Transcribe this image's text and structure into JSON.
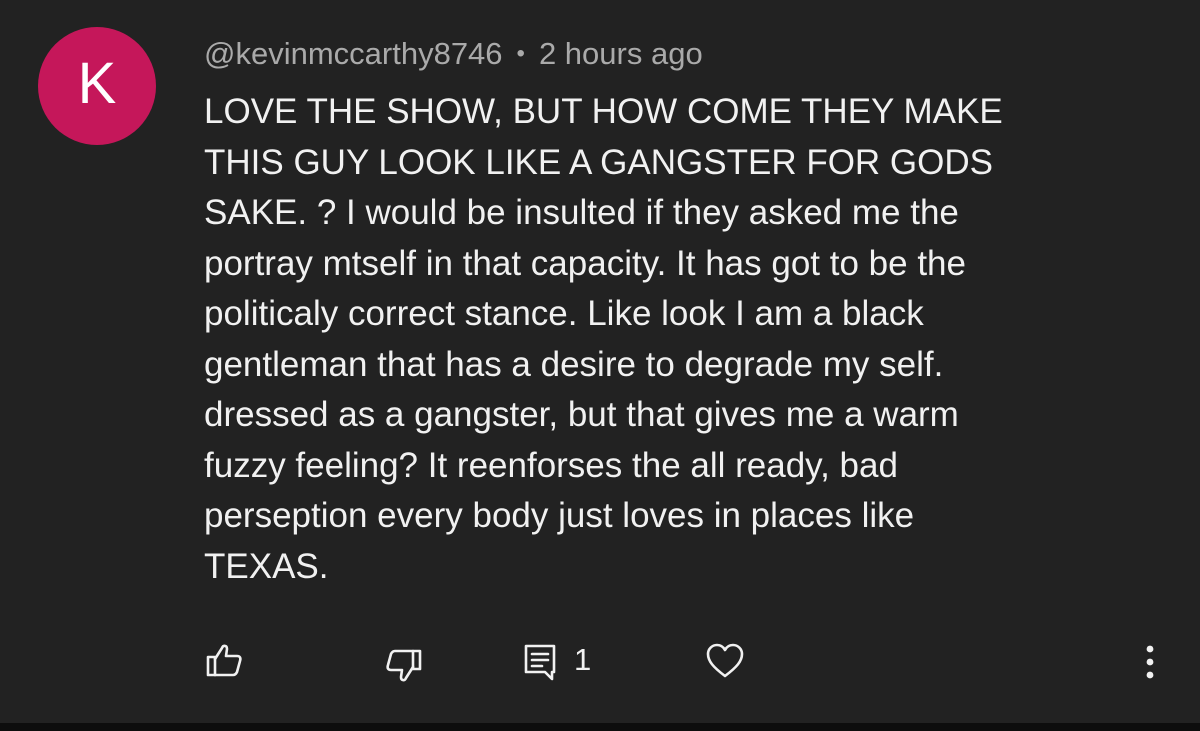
{
  "comment": {
    "avatar_letter": "K",
    "avatar_color": "#c5175a",
    "username": "@kevinmccarthy8746",
    "separator": "•",
    "timestamp": "2 hours ago",
    "text": "LOVE THE SHOW, BUT HOW COME THEY MAKE\nTHIS GUY LOOK LIKE A GANGSTER FOR GODS\nSAKE. ? I  would be insulted if they asked me the\nportray mtself in that capacity.  It has got to be the\npoliticaly correct stance.  Like look I am a black\ngentleman that has a desire to degrade my self.\ndressed as a gangster, but that gives me a warm\nfuzzy feeling?  It reenforses the all ready, bad\nperseption every body just loves in places like\nTEXAS."
  },
  "actions": {
    "like_icon": "thumbs-up-icon",
    "dislike_icon": "thumbs-down-icon",
    "reply_icon": "comment-icon",
    "reply_count": "1",
    "heart_icon": "heart-icon",
    "more_icon": "more-vertical-icon"
  },
  "colors": {
    "background": "#222222",
    "text": "#f1f1f1",
    "meta": "#aaaaaa"
  }
}
